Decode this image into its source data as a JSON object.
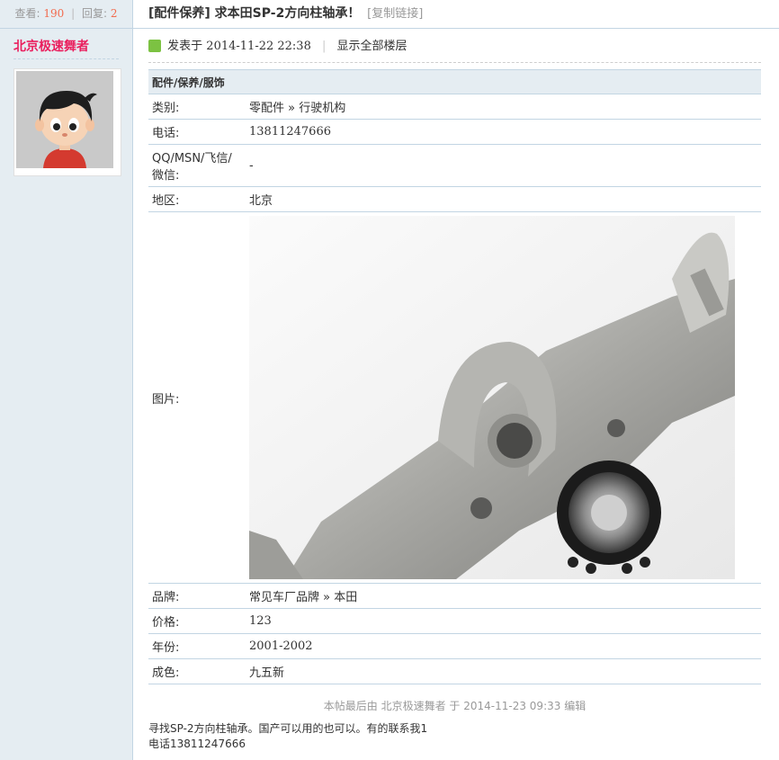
{
  "stats": {
    "views_label": "查看:",
    "views": "190",
    "sep": "|",
    "replies_label": "回复:",
    "replies": "2"
  },
  "author": {
    "name": "北京极速舞者"
  },
  "thread": {
    "title": "[配件保养] 求本田SP-2方向柱轴承！",
    "copy_link": "[复制链接]"
  },
  "post": {
    "posted_label": "发表于",
    "posted_at": "2014-11-22 22:38",
    "pipe": "|",
    "show_all": "显示全部楼层"
  },
  "info_table": {
    "section": "配件/保养/服饰",
    "rows": [
      {
        "label": "类别:",
        "value": "零配件 » 行驶机构"
      },
      {
        "label": "电话:",
        "value": "13811247666"
      },
      {
        "label": "QQ/MSN/飞信/微信:",
        "value": "-"
      },
      {
        "label": "地区:",
        "value": "北京"
      },
      {
        "label": "图片:",
        "value": ""
      },
      {
        "label": "品牌:",
        "value": "常见车厂品牌 » 本田"
      },
      {
        "label": "价格:",
        "value": "123"
      },
      {
        "label": "年份:",
        "value": "2001-2002"
      },
      {
        "label": "成色:",
        "value": "九五新"
      }
    ]
  },
  "edit_note": "本帖最后由 北京极速舞者 于 2014-11-23 09:33 编辑",
  "content": {
    "line1": "寻找SP-2方向柱轴承。国产可以用的也可以。有的联系我1",
    "line2": "电话13811247666"
  },
  "icons": {
    "post_icon": "post-status-icon",
    "avatar": "cartoon-boy-avatar",
    "photo": "steering-column-photo"
  },
  "colors": {
    "author": "#ea1f5e",
    "stat_number": "#f26c4f",
    "sidebar_bg": "#e5edf2",
    "border": "#c2d5e3"
  }
}
